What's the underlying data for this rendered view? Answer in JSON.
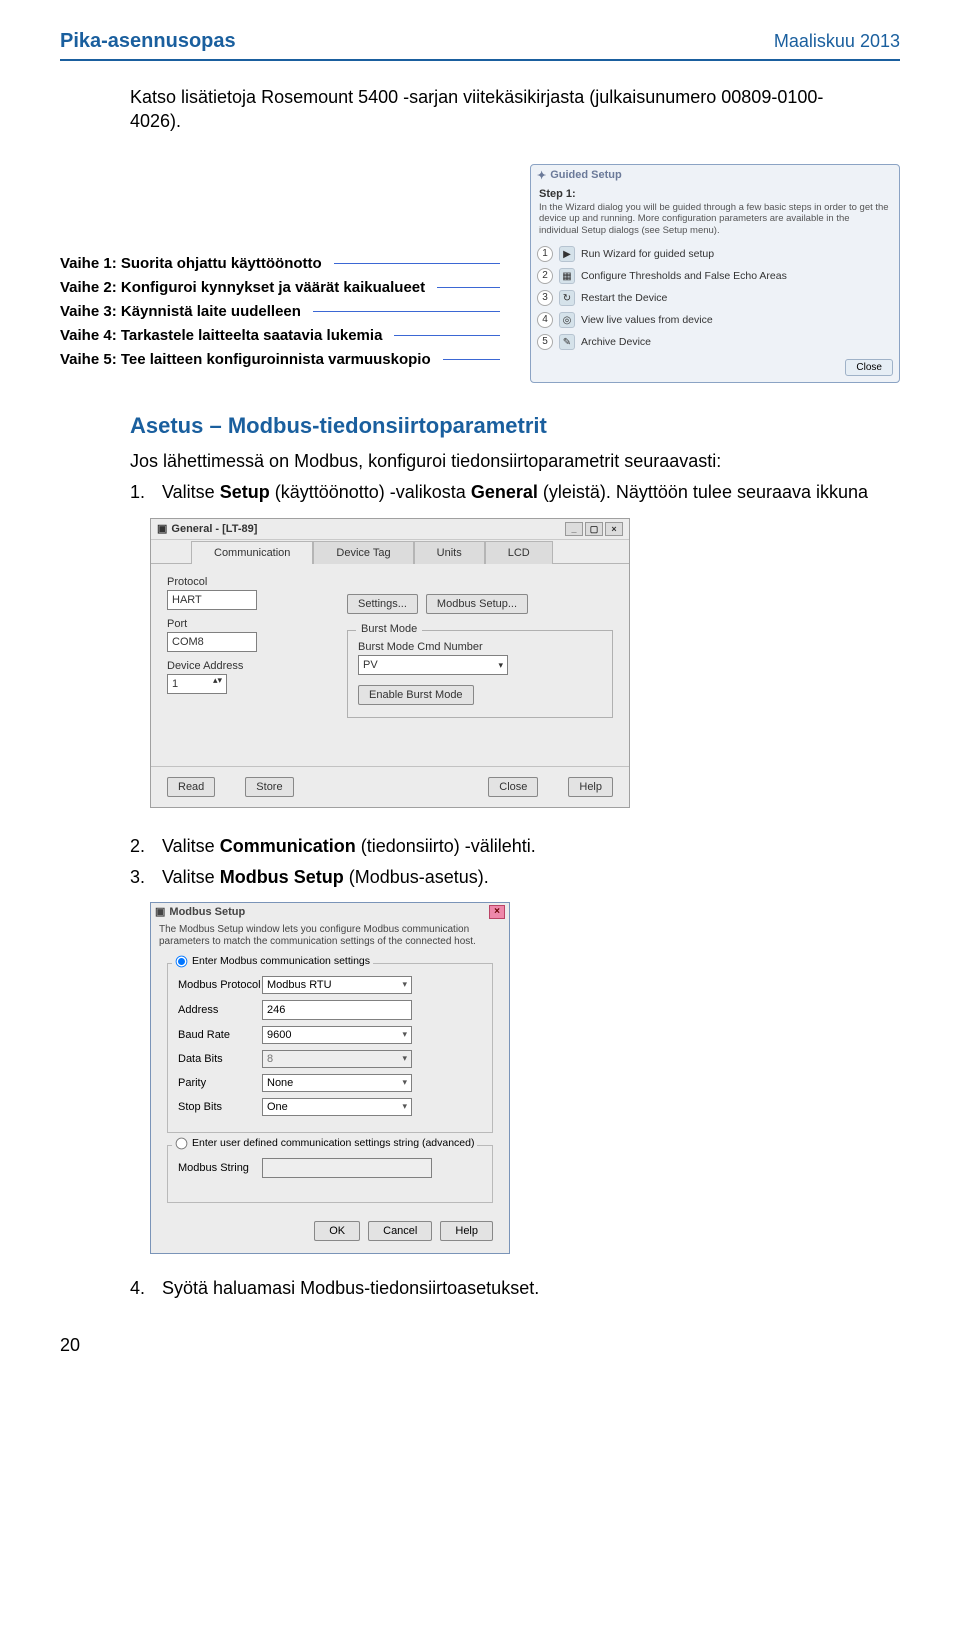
{
  "header": {
    "left": "Pika-asennusopas",
    "right": "Maaliskuu 2013"
  },
  "intro": "Katso lisätietoja Rosemount 5400 -sarjan viitekäsikirjasta (julkaisunumero 00809-0100-4026).",
  "steps": [
    "Vaihe 1: Suorita ohjattu käyttöönotto",
    "Vaihe 2: Konfiguroi kynnykset ja väärät kaikualueet",
    "Vaihe 3: Käynnistä laite uudelleen",
    "Vaihe 4: Tarkastele laitteelta saatavia lukemia",
    "Vaihe 5: Tee laitteen konfiguroinnista varmuuskopio"
  ],
  "guided": {
    "title": "Guided Setup",
    "step_label": "Step 1:",
    "desc": "In the Wizard dialog you will be guided through a few basic steps in order to get the device up and running. More configuration parameters are available in the individual Setup dialogs (see Setup menu).",
    "rows": [
      {
        "n": "1",
        "icon": "▶",
        "label": "Run Wizard for guided setup"
      },
      {
        "n": "2",
        "icon": "▦",
        "label": "Configure Thresholds and False Echo Areas"
      },
      {
        "n": "3",
        "icon": "↻",
        "label": "Restart the Device"
      },
      {
        "n": "4",
        "icon": "◎",
        "label": "View live values from device"
      },
      {
        "n": "5",
        "icon": "✎",
        "label": "Archive Device"
      }
    ],
    "close": "Close"
  },
  "section1": {
    "title": "Asetus – Modbus-tiedonsiirtoparametrit",
    "intro": "Jos lähettimessä on Modbus, konfiguroi tiedonsiirtoparametrit seuraavasti:",
    "step1_num": "1.",
    "step1_a": "Valitse ",
    "step1_b": "Setup",
    "step1_c": " (käyttöönotto) -valikosta ",
    "step1_d": "General",
    "step1_e": " (yleistä). Näyttöön tulee seuraava ikkuna"
  },
  "generalWin": {
    "title": "General - [LT-89]",
    "tabs": [
      "Communication",
      "Device Tag",
      "Units",
      "LCD"
    ],
    "protocol_label": "Protocol",
    "protocol_value": "HART",
    "settings_btn": "Settings...",
    "modbus_btn": "Modbus Setup...",
    "port_label": "Port",
    "port_value": "COM8",
    "devaddr_label": "Device Address",
    "devaddr_value": "1",
    "burst_legend": "Burst Mode",
    "burst_cmd_label": "Burst Mode Cmd Number",
    "burst_cmd_value": "PV",
    "burst_enable_btn": "Enable Burst Mode",
    "buttons": [
      "Read",
      "Store",
      "Close",
      "Help"
    ]
  },
  "section2": {
    "step2_num": "2.",
    "step2_a": "Valitse ",
    "step2_b": "Communication",
    "step2_c": " (tiedonsiirto) -välilehti.",
    "step3_num": "3.",
    "step3_a": "Valitse ",
    "step3_b": "Modbus Setup",
    "step3_c": " (Modbus-asetus)."
  },
  "modbusWin": {
    "title": "Modbus Setup",
    "desc": "The Modbus Setup window lets you configure Modbus communication parameters to match the communication settings of the connected host.",
    "radio1": "Enter Modbus communication settings",
    "fields": {
      "protocol_label": "Modbus Protocol",
      "protocol_value": "Modbus RTU",
      "address_label": "Address",
      "address_value": "246",
      "baud_label": "Baud Rate",
      "baud_value": "9600",
      "databits_label": "Data Bits",
      "databits_value": "8",
      "parity_label": "Parity",
      "parity_value": "None",
      "stop_label": "Stop Bits",
      "stop_value": "One"
    },
    "radio2": "Enter user defined communication settings string (advanced)",
    "string_label": "Modbus String",
    "buttons": [
      "OK",
      "Cancel",
      "Help"
    ]
  },
  "section3": {
    "step4_num": "4.",
    "step4_text": "Syötä haluamasi Modbus-tiedonsiirtoasetukset."
  },
  "pagenum": "20"
}
